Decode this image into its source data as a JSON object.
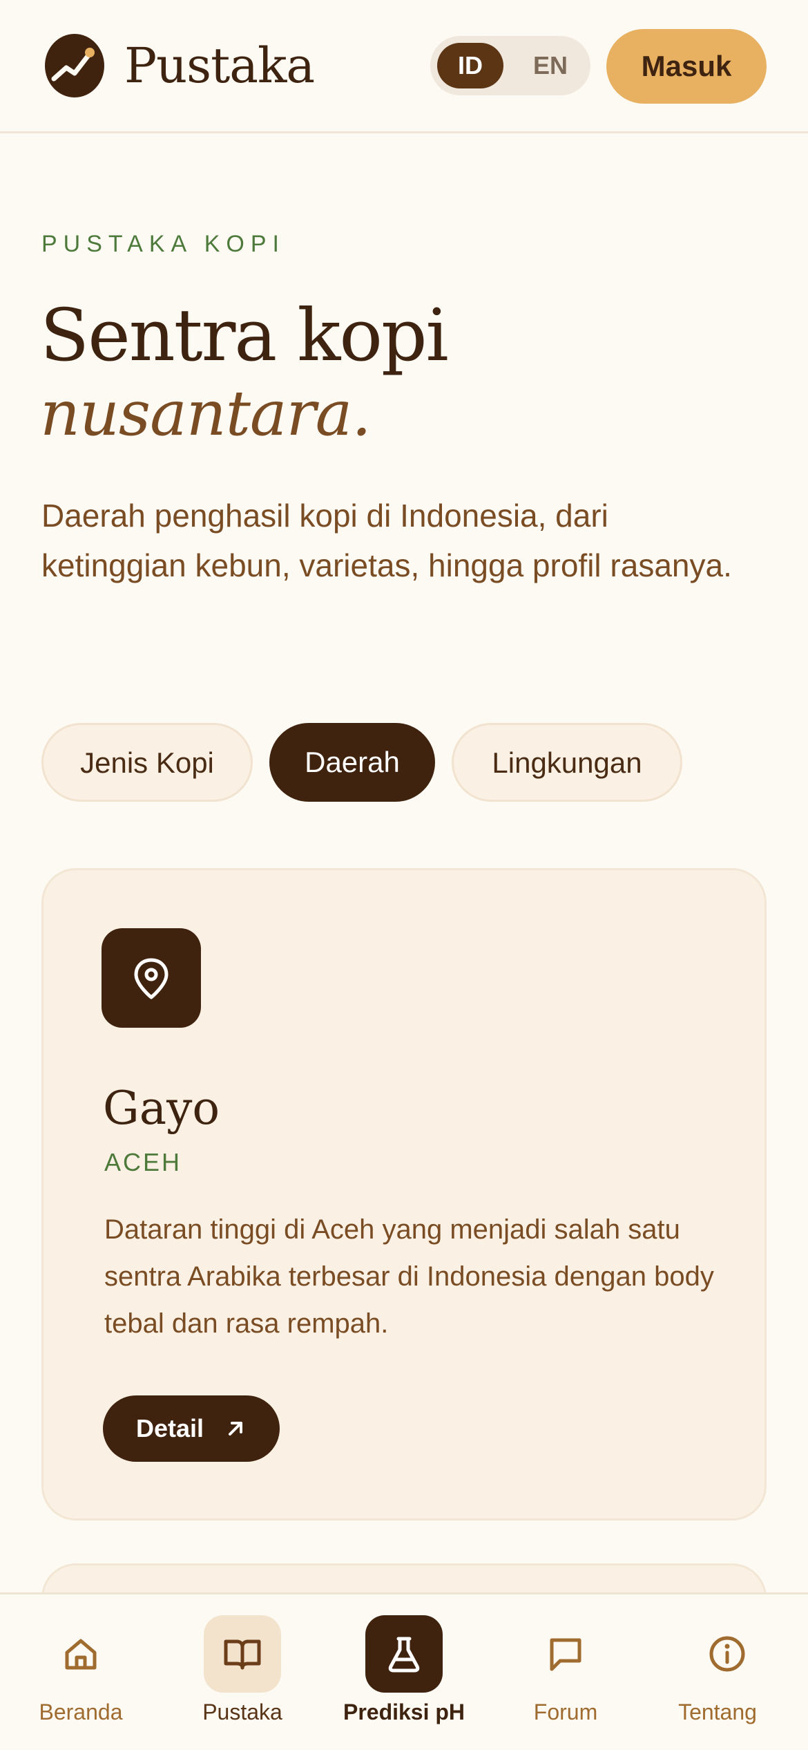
{
  "header": {
    "brand": "Pustaka",
    "lang": {
      "active": "ID",
      "inactive": "EN"
    },
    "login_label": "Masuk"
  },
  "hero": {
    "eyebrow": "PUSTAKA KOPI",
    "title": "Sentra kopi",
    "title_italic": "nusantara.",
    "lead": "Daerah penghasil kopi di Indonesia, dari ketinggian kebun, varietas, hingga profil rasanya."
  },
  "filters": [
    {
      "label": "Jenis Kopi"
    },
    {
      "label": "Daerah",
      "active": true
    },
    {
      "label": "Lingkungan"
    }
  ],
  "card": {
    "icon": "map-pin-icon",
    "title": "Gayo",
    "region": "ACEH",
    "description": "Dataran tinggi di Aceh yang menjadi salah satu sentra Arabika terbesar di Indonesia dengan body tebal dan rasa rempah.",
    "detail_label": "Detail"
  },
  "nav": {
    "items": [
      {
        "label": "Beranda",
        "icon": "home-icon"
      },
      {
        "label": "Pustaka",
        "icon": "book-icon",
        "state": "current"
      },
      {
        "label": "Prediksi pH",
        "icon": "flask-icon",
        "state": "highlighted"
      },
      {
        "label": "Forum",
        "icon": "chat-icon"
      },
      {
        "label": "Tentang",
        "icon": "info-icon"
      }
    ]
  },
  "colors": {
    "background": "#fdfaf4",
    "primary_dark": "#40230f",
    "accent": "#e8b162",
    "green": "#4d7a3a",
    "brown_text": "#7a4c24"
  }
}
